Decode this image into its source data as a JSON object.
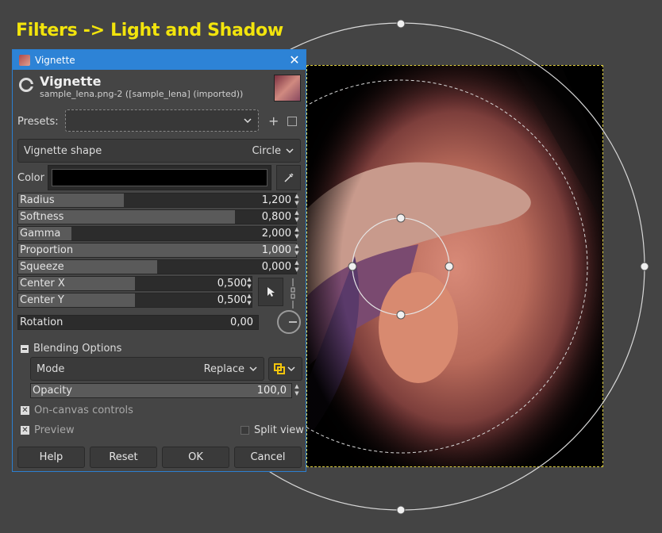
{
  "caption": "Filters -> Light and Shadow",
  "dialog": {
    "window_title": "Vignette",
    "title": "Vignette",
    "subtitle": "sample_lena.png-2 ([sample_lena] (imported))",
    "presets_label": "Presets:",
    "presets_value": "",
    "shape_label": "Vignette shape",
    "shape_value": "Circle",
    "color_label": "Color",
    "color_value": "#000000",
    "sliders": [
      {
        "label": "Radius",
        "value": "1,200",
        "fraction": 0.38
      },
      {
        "label": "Softness",
        "value": "0,800",
        "fraction": 0.78
      },
      {
        "label": "Gamma",
        "value": "2,000",
        "fraction": 0.19
      },
      {
        "label": "Proportion",
        "value": "1,000",
        "fraction": 1.0
      },
      {
        "label": "Squeeze",
        "value": "0,000",
        "fraction": 0.5
      },
      {
        "label": "Center X",
        "value": "0,500",
        "fraction": 0.5
      },
      {
        "label": "Center Y",
        "value": "0,500",
        "fraction": 0.5
      },
      {
        "label": "Rotation",
        "value": "0,00",
        "fraction": 0.0
      }
    ],
    "blending_label": "Blending Options",
    "mode_label": "Mode",
    "mode_value": "Replace",
    "opacity_label": "Opacity",
    "opacity_value": "100,0",
    "on_canvas_label": "On-canvas controls",
    "preview_label": "Preview",
    "split_view_label": "Split view",
    "buttons": {
      "help": "Help",
      "reset": "Reset",
      "ok": "OK",
      "cancel": "Cancel"
    }
  },
  "colors": {
    "accent": "#2d83d6",
    "caption": "#f2e40c",
    "canvas_bg": "#444444"
  }
}
